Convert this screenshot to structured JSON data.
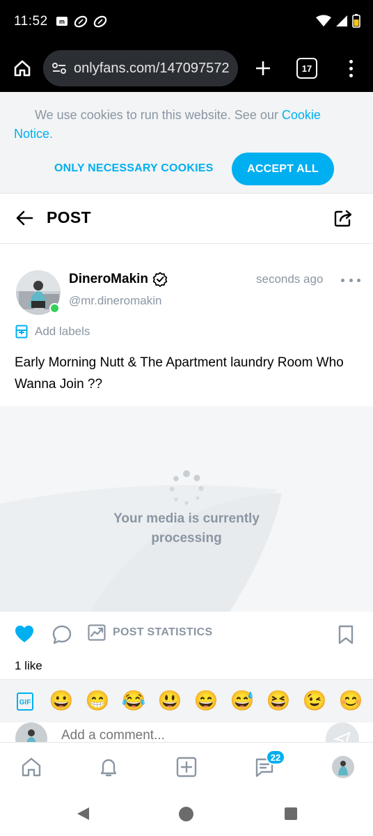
{
  "status_bar": {
    "time": "11:52",
    "left_icons": [
      "mail-icon",
      "football-icon",
      "football-icon"
    ],
    "right_icons": [
      "wifi-icon",
      "signal-icon",
      "battery-icon"
    ]
  },
  "browser": {
    "url": "onlyfans.com/147097572",
    "tab_count": "17"
  },
  "cookie_banner": {
    "text_before_link": "We use cookies to run this website. See our ",
    "link_text": "Cookie Notice",
    "text_after_link": ".",
    "only_necessary_label": "ONLY NECESSARY COOKIES",
    "accept_all_label": "ACCEPT ALL"
  },
  "header": {
    "title": "POST"
  },
  "post": {
    "author_name": "DineroMakin",
    "author_handle": "@mr.dineromakin",
    "timestamp": "seconds ago",
    "add_labels": "Add labels",
    "text": "Early Morning Nutt & The Apartment laundry Room Who Wanna Join ??",
    "media_status": "Your media is currently processing",
    "post_statistics_label": "POST STATISTICS",
    "likes": "1 like",
    "liked": true
  },
  "emoji_bar": {
    "gif_label": "GIF",
    "emojis": [
      "😀",
      "😁",
      "😂",
      "😃",
      "😄",
      "😅",
      "😆",
      "😉",
      "😊"
    ]
  },
  "comment": {
    "placeholder": "Add a comment..."
  },
  "bottom_nav": {
    "messages_badge": "22",
    "items": [
      "home-icon",
      "bell-icon",
      "add-post-icon",
      "messages-icon",
      "profile-avatar"
    ]
  },
  "colors": {
    "accent": "#00aff0",
    "muted": "#8a96a3",
    "online": "#34d058",
    "banner_bg": "#f2f4f5"
  }
}
